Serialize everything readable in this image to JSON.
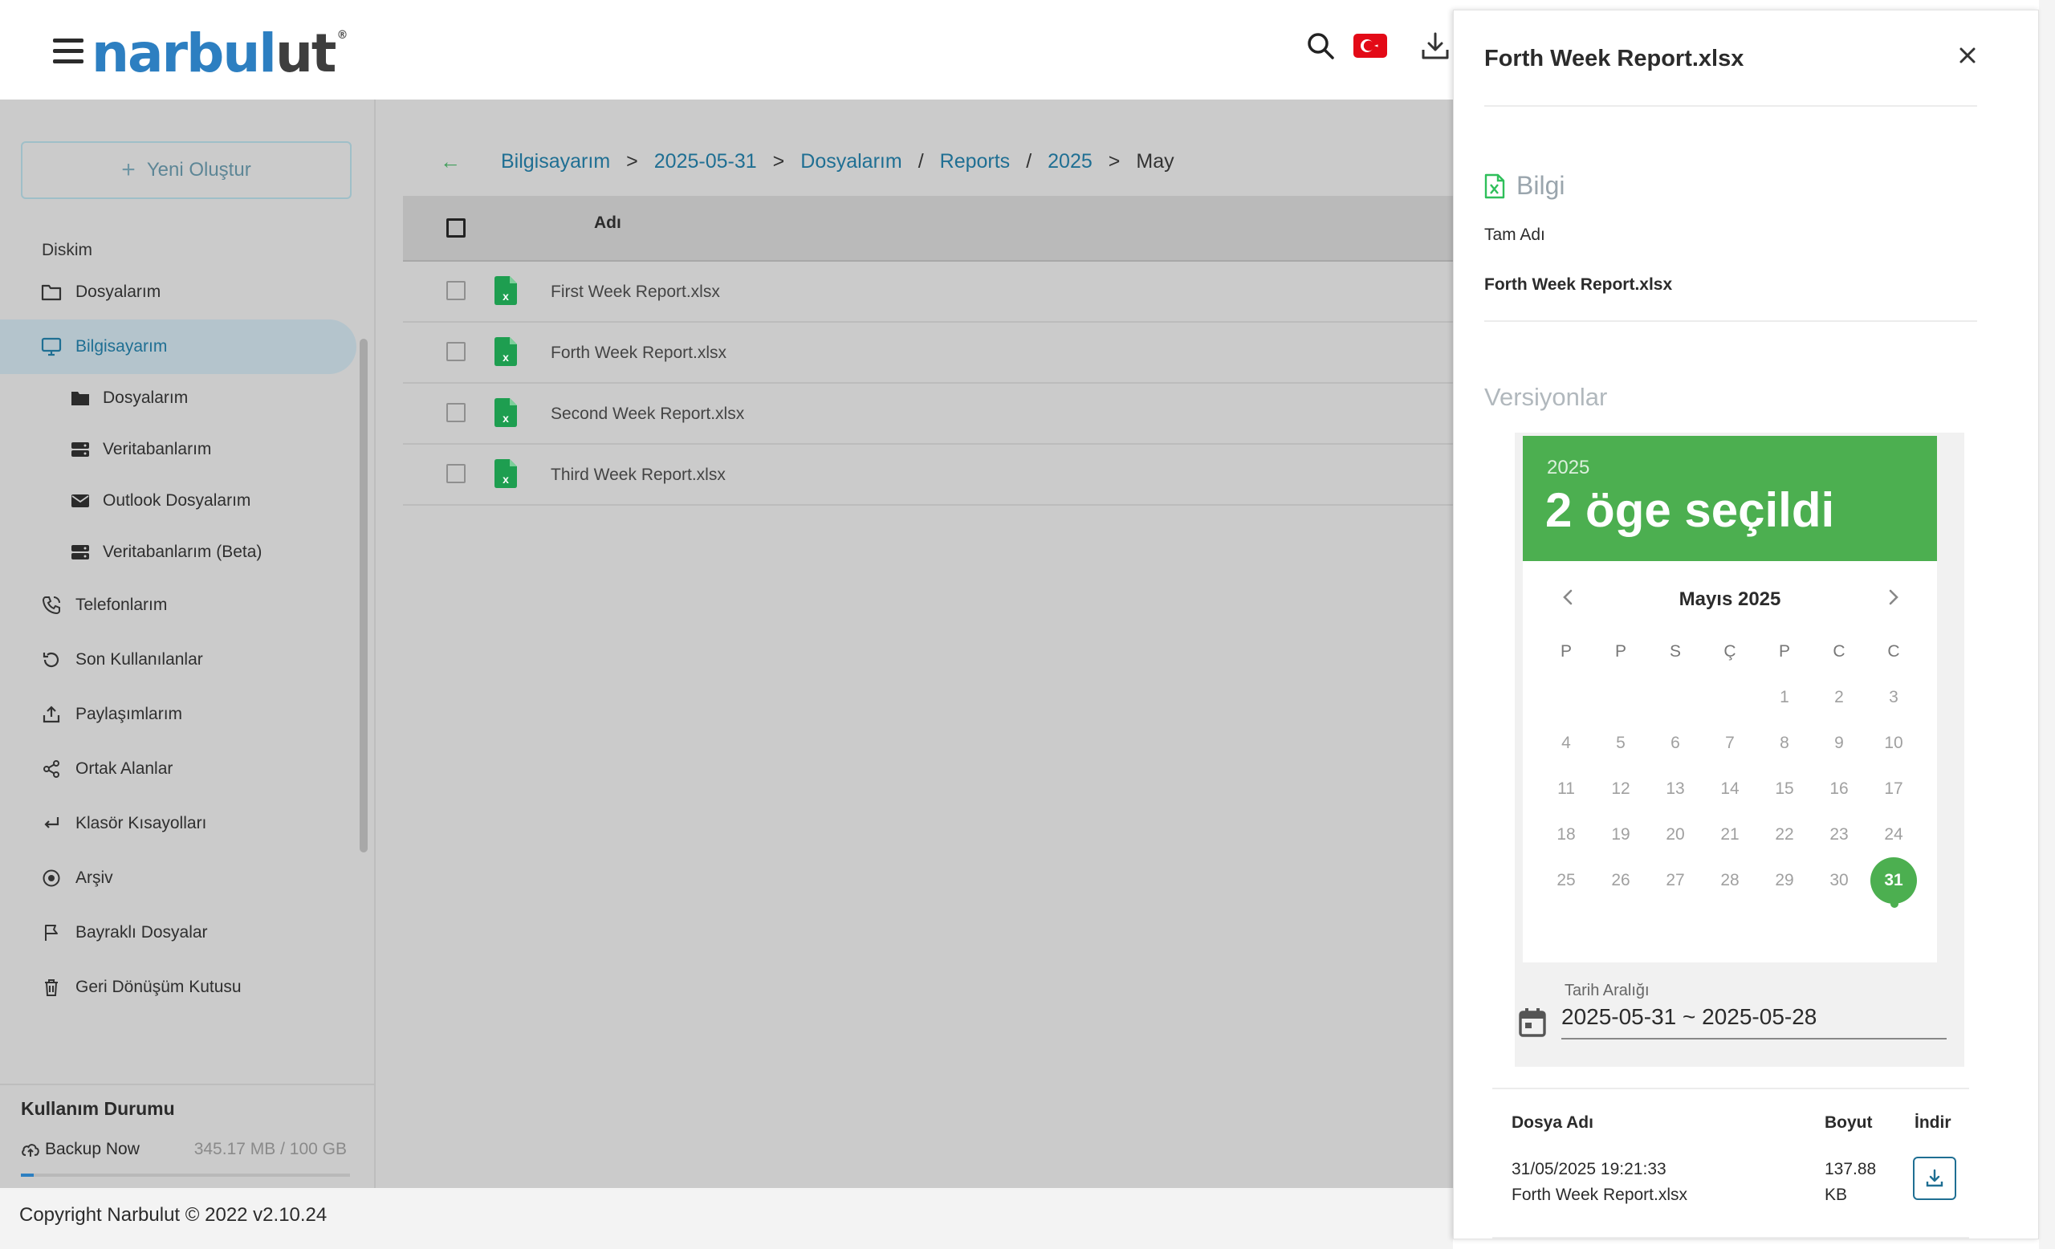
{
  "app": {
    "logo_main": "narbul",
    "logo_tail": "ut",
    "logo_reg": "®"
  },
  "colors": {
    "brand_blue": "#2d7fc1",
    "accent_green": "#4caf50",
    "link": "#1f6f93",
    "flag_red": "#e30a17"
  },
  "topbar": {
    "icons": [
      "menu-icon",
      "search-icon",
      "turkish-flag-icon",
      "download-icon"
    ]
  },
  "sidebar": {
    "new_button": "Yeni Oluştur",
    "section_label": "Diskim",
    "items": [
      {
        "label": "Dosyalarım",
        "icon": "folder-icon"
      },
      {
        "label": "Bilgisayarım",
        "icon": "monitor-icon",
        "active": true
      },
      {
        "label": "Dosyalarım",
        "icon": "folder-filled-icon"
      },
      {
        "label": "Veritabanlarım",
        "icon": "database-icon"
      },
      {
        "label": "Outlook Dosyalarım",
        "icon": "mail-icon"
      },
      {
        "label": "Veritabanlarım (Beta)",
        "icon": "database-icon"
      },
      {
        "label": "Telefonlarım",
        "icon": "phone-icon"
      },
      {
        "label": "Son Kullanılanlar",
        "icon": "history-icon"
      },
      {
        "label": "Paylaşımlarım",
        "icon": "share-upload-icon"
      },
      {
        "label": "Ortak Alanlar",
        "icon": "share-nodes-icon"
      },
      {
        "label": "Klasör Kısayolları",
        "icon": "shortcut-icon"
      },
      {
        "label": "Arşiv",
        "icon": "archive-icon"
      },
      {
        "label": "Bayraklı Dosyalar",
        "icon": "flag-icon"
      },
      {
        "label": "Geri Dönüşüm Kutusu",
        "icon": "trash-icon"
      }
    ],
    "usage_title": "Kullanım Durumu",
    "backup_label": "Backup Now",
    "quota": "345.17 MB / 100 GB",
    "usage_fraction": 0.003
  },
  "breadcrumb": {
    "items": [
      "Bilgisayarım",
      ">",
      "2025-05-31",
      ">",
      "Dosyalarım",
      "/",
      "Reports",
      "/",
      "2025",
      ">",
      "May"
    ]
  },
  "table": {
    "column_name": "Adı",
    "rows": [
      {
        "name": "First Week Report.xlsx"
      },
      {
        "name": "Forth Week Report.xlsx"
      },
      {
        "name": "Second Week Report.xlsx"
      },
      {
        "name": "Third Week Report.xlsx"
      }
    ]
  },
  "footer": {
    "text": "Copyright Narbulut © 2022  v2.10.24"
  },
  "drawer": {
    "title": "Forth Week Report.xlsx",
    "info_heading": "Bilgi",
    "full_name_label": "Tam Adı",
    "full_name_value": "Forth Week Report.xlsx",
    "versions_heading": "Versiyonlar",
    "picker": {
      "year": "2025",
      "selection": "2 öge seçildi",
      "month": "Mayıs 2025",
      "weekdays": [
        "P",
        "P",
        "S",
        "Ç",
        "P",
        "C",
        "C"
      ],
      "weeks": [
        [
          "",
          "",
          "",
          "",
          "1",
          "2",
          "3"
        ],
        [
          "4",
          "5",
          "6",
          "7",
          "8",
          "9",
          "10"
        ],
        [
          "11",
          "12",
          "13",
          "14",
          "15",
          "16",
          "17"
        ],
        [
          "18",
          "19",
          "20",
          "21",
          "22",
          "23",
          "24"
        ],
        [
          "25",
          "26",
          "27",
          "28",
          "29",
          "30",
          "31"
        ]
      ],
      "selected_day": "31",
      "range_label": "Tarih Aralığı",
      "range_value": "2025-05-31 ~ 2025-05-28"
    },
    "versions_table": {
      "col_file": "Dosya Adı",
      "col_size": "Boyut",
      "col_download": "İndir",
      "rows": [
        {
          "date": "31/05/2025 19:21:33",
          "file": "Forth Week Report.xlsx",
          "size_value": "137.88",
          "size_unit": "KB"
        }
      ]
    }
  }
}
